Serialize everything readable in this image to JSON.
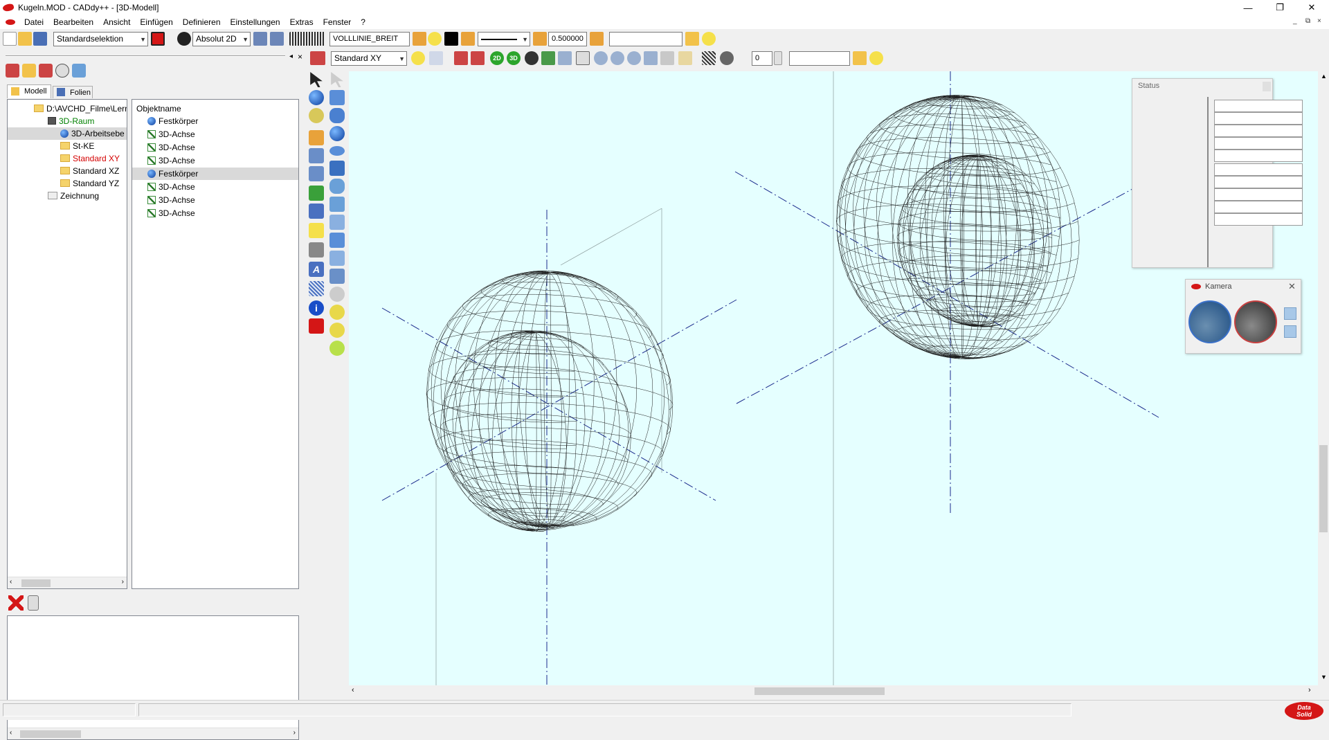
{
  "window": {
    "title": "Kugeln.MOD  -  CADdy++ - [3D-Modell]",
    "minimize_glyph": "—",
    "restore_glyph": "❐",
    "close_glyph": "✕"
  },
  "menu": {
    "items": [
      "Datei",
      "Bearbeiten",
      "Ansicht",
      "Einfügen",
      "Definieren",
      "Einstellungen",
      "Extras",
      "Fenster",
      "?"
    ],
    "mdi_minimize": "_",
    "mdi_restore": "⧉",
    "mdi_close": "×"
  },
  "toolbar1": {
    "selection_mode": "Standardselektion",
    "coordinate_mode": "Absolut 2D",
    "line_type": "VOLLLINIE_BREIT",
    "line_width": "0.500000",
    "text_field": ""
  },
  "toolbar2": {
    "view_plane": "Standard XY",
    "label_2d": "2D",
    "label_3d": "3D",
    "spin_value": "0",
    "text_field": ""
  },
  "left_panel": {
    "pin_glyph": "◂",
    "close_glyph": "×",
    "tabs": [
      "Modell",
      "Folien"
    ],
    "tree": [
      {
        "label": "D:\\AVCHD_Filme\\Lern",
        "icon": "folder-icon",
        "color": "#000000"
      },
      {
        "label": "3D-Raum",
        "icon": "camera-icon",
        "color": "#008000"
      },
      {
        "label": "3D-Arbeitsebe",
        "icon": "sphere-icon",
        "color": "#000000",
        "selected": true
      },
      {
        "label": "St-KE",
        "icon": "folder-icon",
        "color": "#000000"
      },
      {
        "label": "Standard XY",
        "icon": "folder-icon",
        "color": "#d40000"
      },
      {
        "label": "Standard XZ",
        "icon": "folder-icon",
        "color": "#000000"
      },
      {
        "label": "Standard YZ",
        "icon": "folder-icon",
        "color": "#000000"
      },
      {
        "label": "Zeichnung",
        "icon": "folder-icon",
        "color": "#000000"
      }
    ],
    "objects_header": "Objektname",
    "objects": [
      {
        "label": "Festkörper",
        "icon": "sphere-icon"
      },
      {
        "label": "3D-Achse",
        "icon": "axis-icon"
      },
      {
        "label": "3D-Achse",
        "icon": "axis-icon"
      },
      {
        "label": "3D-Achse",
        "icon": "axis-icon"
      },
      {
        "label": "Festkörper",
        "icon": "sphere-icon",
        "selected": true
      },
      {
        "label": "3D-Achse",
        "icon": "axis-icon"
      },
      {
        "label": "3D-Achse",
        "icon": "axis-icon"
      },
      {
        "label": "3D-Achse",
        "icon": "axis-icon"
      }
    ]
  },
  "status_panel": {
    "title": "Status",
    "rows": 10
  },
  "camera_panel": {
    "title": "Kamera",
    "close_glyph": "✕"
  },
  "statusbar": {
    "pane1": "",
    "pane2": "",
    "logo_top": "Data",
    "logo_bottom": "Solid"
  },
  "colors": {
    "viewport_bg": "#e5ffff",
    "mesh": "#1a1a1a",
    "axis": "#1a2a8c",
    "accent_red": "#d41616"
  }
}
